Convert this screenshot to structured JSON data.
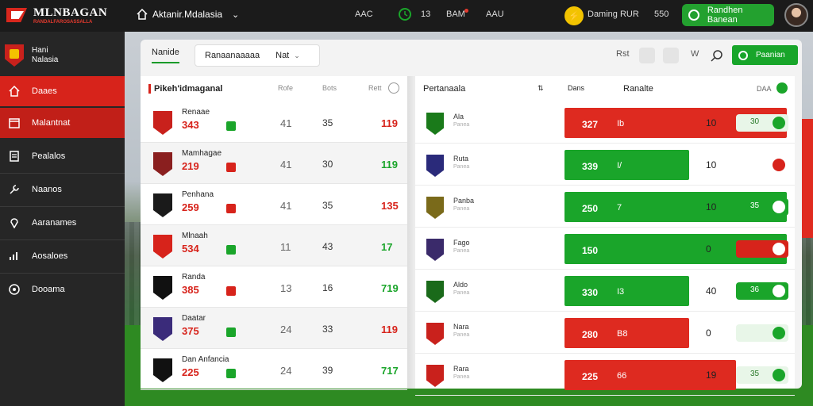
{
  "brand": {
    "title": "MLNBAGAN",
    "subtitle": "RANDALFAROSASSALLA"
  },
  "topbar": {
    "nav_label": "Aktanir.Mdalasia",
    "items": [
      "AAC",
      "13",
      "BAM",
      "AAU"
    ],
    "action_label": "Daming RUR",
    "count": "550",
    "cta_label": "Randhen Banean"
  },
  "sidebar": {
    "brand_line1": "Hani",
    "brand_line2": "Nalasia",
    "items": [
      {
        "label": "Daaes",
        "icon": "home-icon"
      },
      {
        "label": "Malantnat",
        "icon": "calendar-icon"
      },
      {
        "label": "Pealalos",
        "icon": "document-icon"
      },
      {
        "label": "Naanos",
        "icon": "tool-icon"
      },
      {
        "label": "Aaranames",
        "icon": "pin-icon"
      },
      {
        "label": "Aosaloes",
        "icon": "chart-icon"
      },
      {
        "label": "Dooama",
        "icon": "ball-icon"
      }
    ]
  },
  "panel": {
    "tab_active": "Nanide",
    "tab_box_1": "Ranaanaaaaa",
    "tab_box_2": "Nat",
    "filter_button": "Paanian",
    "icon_letters": [
      "Rst",
      "W"
    ]
  },
  "left_table": {
    "title": "Pikeh'idmaganal",
    "headers": [
      "Rofe",
      "Bots",
      "Rett"
    ],
    "rows": [
      {
        "name": "Renaae",
        "score": "343",
        "v1": "41",
        "v2": "35",
        "v3": "119",
        "v3_color": "#d7231b",
        "badge": "#c9211c",
        "marker": "#1aa52a"
      },
      {
        "name": "Mamhagae",
        "score": "219",
        "v1": "41",
        "v2": "30",
        "v3": "119",
        "v3_color": "#1aa52a",
        "badge": "#8a1f1f",
        "marker": "#d7231b"
      },
      {
        "name": "Penhana",
        "score": "259",
        "v1": "41",
        "v2": "35",
        "v3": "135",
        "v3_color": "#d7231b",
        "badge": "#1a1a1a",
        "marker": "#d7231b"
      },
      {
        "name": "Mlnaah",
        "score": "534",
        "v1": "11",
        "v2": "43",
        "v3": "17",
        "v3_color": "#1aa52a",
        "badge": "#d7231b",
        "marker": "#1aa52a"
      },
      {
        "name": "Randa",
        "score": "385",
        "v1": "13",
        "v2": "16",
        "v3": "719",
        "v3_color": "#1aa52a",
        "badge": "#111",
        "marker": "#d7231b"
      },
      {
        "name": "Daatar",
        "score": "375",
        "v1": "24",
        "v2": "33",
        "v3": "119",
        "v3_color": "#d7231b",
        "badge": "#3a2b7a",
        "marker": "#1aa52a"
      },
      {
        "name": "Dan Anfancia",
        "score": "225",
        "v1": "24",
        "v2": "39",
        "v3": "717",
        "v3_color": "#1aa52a",
        "badge": "#111",
        "marker": "#1aa52a"
      }
    ]
  },
  "right_table": {
    "title": "Pertanaala",
    "headers": [
      "Dans",
      "Ranalte",
      "DAA"
    ],
    "rows": [
      {
        "name": "Ala",
        "sub": "Panea",
        "bar_value": "327",
        "bar_mark": "Ib",
        "bar_color": "#de2a20",
        "bar_fraction": 1.0,
        "rv": "10",
        "pill_value": "30",
        "pill_color": "#1aa52a",
        "pill_bg": "#e8f6e8",
        "badge": "#1a7a1a"
      },
      {
        "name": "Ruta",
        "sub": "Panea",
        "bar_value": "339",
        "bar_mark": "I/",
        "bar_color": "#1aa52a",
        "bar_fraction": 0.56,
        "rv": "10",
        "pill_value": "",
        "pill_color": "#d7231b",
        "pill_bg": "#ffffff",
        "badge": "#2a2a7a"
      },
      {
        "name": "Panba",
        "sub": "Panea",
        "bar_value": "250",
        "bar_mark": "7",
        "bar_color": "#1aa52a",
        "bar_fraction": 1.0,
        "rv": "10",
        "pill_value": "35",
        "pill_color": "#1aa52a",
        "pill_bg": "#1aa52a",
        "badge": "#7a6a1a"
      },
      {
        "name": "Fago",
        "sub": "Panea",
        "bar_value": "150",
        "bar_mark": "",
        "bar_color": "#1aa52a",
        "bar_fraction": 1.0,
        "rv": "0",
        "pill_value": "",
        "pill_color": "#d7231b",
        "pill_bg": "#d7231b",
        "badge": "#3a2a6a"
      },
      {
        "name": "Aldo",
        "sub": "Panea",
        "bar_value": "330",
        "bar_mark": "I3",
        "bar_color": "#1aa52a",
        "bar_fraction": 0.56,
        "rv": "40",
        "pill_value": "36",
        "pill_color": "#1aa52a",
        "pill_bg": "#1aa52a",
        "badge": "#1a6a1a"
      },
      {
        "name": "Nara",
        "sub": "Panea",
        "bar_value": "280",
        "bar_mark": "B8",
        "bar_color": "#de2a20",
        "bar_fraction": 0.56,
        "rv": "0",
        "pill_value": "",
        "pill_color": "#1aa52a",
        "pill_bg": "#e8f6e8",
        "badge": "#c9211c"
      },
      {
        "name": "Rara",
        "sub": "Panea",
        "bar_value": "225",
        "bar_mark": "66",
        "bar_color": "#de2a20",
        "bar_fraction": 0.77,
        "rv": "19",
        "pill_value": "35",
        "pill_color": "#1aa52a",
        "pill_bg": "#e8f6e8",
        "badge": "#c9211c"
      }
    ]
  }
}
